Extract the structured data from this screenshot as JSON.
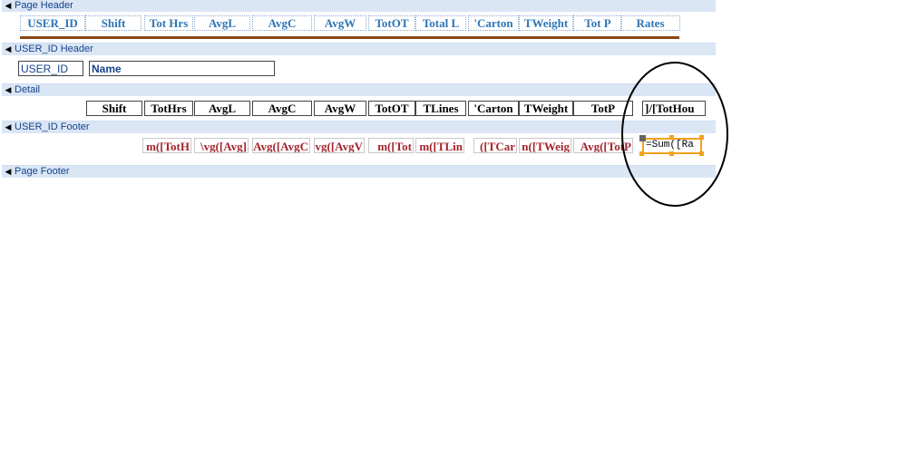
{
  "sections": {
    "page_header": "Page Header",
    "userid_header": "USER_ID Header",
    "detail": "Detail",
    "userid_footer": "USER_ID Footer",
    "page_footer": "Page Footer"
  },
  "page_header_labels": [
    "USER_ID",
    "Shift",
    "Tot Hrs",
    "AvgL",
    "AvgC",
    "AvgW",
    "TotOT",
    "Total L",
    "'Carton",
    "TWeight",
    "Tot P",
    "Rates"
  ],
  "userid_header_fields": {
    "userid": "USER_ID",
    "name": "Name"
  },
  "detail_fields": [
    "Shift",
    "TotHrs",
    "AvgL",
    "AvgC",
    "AvgW",
    "TotOT",
    "TLines",
    "'Carton",
    "TWeight",
    "TotP",
    "]/[TotHou"
  ],
  "footer_fields": [
    "m([TotH",
    "\\vg([Avg]",
    "Avg([AvgC",
    "vg([AvgV",
    "m([Tot",
    "m([TLin",
    "([TCar",
    "n([TWeig",
    "Avg([TotP",
    "=Sum([Ra"
  ],
  "colors": {
    "band": "#dbe6f5",
    "band_text": "#15428b",
    "label_text": "#2e75b6",
    "footer_text": "#a3242c",
    "selection": "#f4a21c"
  }
}
